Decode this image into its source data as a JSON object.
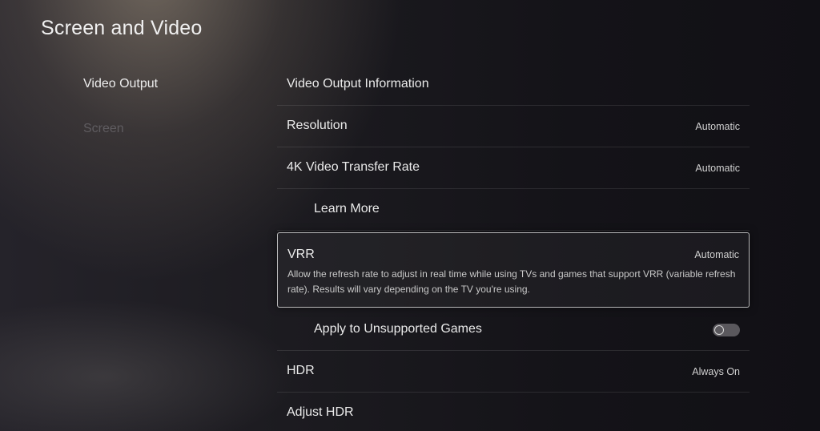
{
  "header": {
    "title": "Screen and Video"
  },
  "sidebar": {
    "items": [
      {
        "label": "Video Output",
        "state": "selected"
      },
      {
        "label": "Screen",
        "state": "dimmed"
      }
    ]
  },
  "settings": {
    "video_output_information": {
      "label": "Video Output Information"
    },
    "resolution": {
      "label": "Resolution",
      "value": "Automatic"
    },
    "video_transfer_rate": {
      "label": "4K Video Transfer Rate",
      "value": "Automatic"
    },
    "learn_more": {
      "label": "Learn More"
    },
    "vrr": {
      "label": "VRR",
      "value": "Automatic",
      "description": "Allow the refresh rate to adjust in real time while using TVs and games that support VRR (variable refresh rate). Results will vary depending on the TV you're using."
    },
    "apply_unsupported": {
      "label": "Apply to Unsupported Games",
      "toggle_on": false
    },
    "hdr": {
      "label": "HDR",
      "value": "Always On"
    },
    "adjust_hdr": {
      "label": "Adjust HDR"
    }
  },
  "colors": {
    "focus_border": "#ebebeb",
    "text_primary": "#eaeaea",
    "text_dimmed": "#5f5c60"
  }
}
